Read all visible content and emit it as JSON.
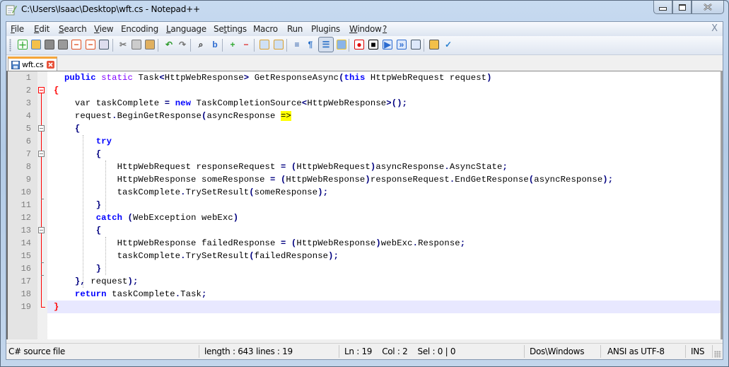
{
  "window": {
    "title": "C:\\Users\\Isaac\\Desktop\\wft.cs - Notepad++",
    "controls": [
      "minimize",
      "maximize",
      "close"
    ]
  },
  "menu": {
    "items": [
      {
        "label": "File",
        "accel": "F"
      },
      {
        "label": "Edit",
        "accel": "E"
      },
      {
        "label": "Search",
        "accel": "S"
      },
      {
        "label": "View",
        "accel": "V"
      },
      {
        "label": "Encoding",
        "accel": ""
      },
      {
        "label": "Language",
        "accel": "L"
      },
      {
        "label": "Settings",
        "accel": "t"
      },
      {
        "label": "Macro",
        "accel": ""
      },
      {
        "label": "Run",
        "accel": ""
      },
      {
        "label": "Plugins",
        "accel": ""
      },
      {
        "label": "Window",
        "accel": "W"
      },
      {
        "label": "?",
        "accel": "?"
      }
    ],
    "close_label": "X"
  },
  "toolbar": {
    "buttons": [
      "new-file-icon",
      "open-file-icon",
      "save-icon",
      "save-all-icon",
      "close-icon",
      "close-all-icon",
      "print-icon",
      "cut-icon",
      "copy-icon",
      "paste-icon",
      "undo-icon",
      "redo-icon",
      "find-icon",
      "replace-icon",
      "zoom-in-icon",
      "zoom-out-icon",
      "sync-vertical-icon",
      "sync-horizontal-icon",
      "word-wrap-icon",
      "show-all-chars-icon",
      "indent-guide-icon",
      "user-language-icon",
      "record-macro-icon",
      "stop-macro-icon",
      "play-macro-icon",
      "run-macro-multiple-icon",
      "save-macro-icon",
      "folder-as-workspace-icon",
      "spell-check-icon"
    ],
    "active": "indent-guide-icon"
  },
  "tabs": [
    {
      "label": "wft.cs",
      "active": true
    }
  ],
  "editor": {
    "current_line": 19,
    "lines": [
      {
        "n": "1",
        "tokens": [
          [
            "",
            "  "
          ],
          [
            "kw",
            "public"
          ],
          [
            "",
            " "
          ],
          [
            "kw2",
            "static"
          ],
          [
            "",
            " Task"
          ],
          [
            "op",
            "<"
          ],
          [
            "",
            "HttpWebResponse"
          ],
          [
            "op",
            ">"
          ],
          [
            "",
            " GetResponseAsync"
          ],
          [
            "op",
            "("
          ],
          [
            "kw",
            "this"
          ],
          [
            "",
            " HttpWebRequest request"
          ],
          [
            "op",
            ")"
          ]
        ]
      },
      {
        "n": "2",
        "tokens": [
          [
            "red",
            "{"
          ]
        ]
      },
      {
        "n": "3",
        "tokens": [
          [
            "",
            "    var taskComplete "
          ],
          [
            "op",
            "="
          ],
          [
            "",
            " "
          ],
          [
            "kw",
            "new"
          ],
          [
            "",
            " TaskCompletionSource"
          ],
          [
            "op",
            "<"
          ],
          [
            "",
            "HttpWebResponse"
          ],
          [
            "op",
            ">();"
          ]
        ]
      },
      {
        "n": "4",
        "tokens": [
          [
            "",
            "    request"
          ],
          [
            "op",
            "."
          ],
          [
            "",
            "BeginGetResponse"
          ],
          [
            "op",
            "("
          ],
          [
            "",
            "asyncResponse "
          ],
          [
            "hl",
            "=>"
          ]
        ]
      },
      {
        "n": "5",
        "tokens": [
          [
            "",
            "    "
          ],
          [
            "op",
            "{"
          ]
        ]
      },
      {
        "n": "6",
        "tokens": [
          [
            "",
            "        "
          ],
          [
            "kw",
            "try"
          ]
        ]
      },
      {
        "n": "7",
        "tokens": [
          [
            "",
            "        "
          ],
          [
            "op",
            "{"
          ]
        ]
      },
      {
        "n": "8",
        "tokens": [
          [
            "",
            "            HttpWebRequest responseRequest "
          ],
          [
            "op",
            "="
          ],
          [
            "",
            " "
          ],
          [
            "op",
            "("
          ],
          [
            "",
            "HttpWebRequest"
          ],
          [
            "op",
            ")"
          ],
          [
            "",
            "asyncResponse"
          ],
          [
            "op",
            "."
          ],
          [
            "",
            "AsyncState"
          ],
          [
            "op",
            ";"
          ]
        ]
      },
      {
        "n": "9",
        "tokens": [
          [
            "",
            "            HttpWebResponse someResponse "
          ],
          [
            "op",
            "="
          ],
          [
            "",
            " "
          ],
          [
            "op",
            "("
          ],
          [
            "",
            "HttpWebResponse"
          ],
          [
            "op",
            ")"
          ],
          [
            "",
            "responseRequest"
          ],
          [
            "op",
            "."
          ],
          [
            "",
            "EndGetResponse"
          ],
          [
            "op",
            "("
          ],
          [
            "",
            "asyncResponse"
          ],
          [
            "op",
            ");"
          ]
        ]
      },
      {
        "n": "10",
        "tokens": [
          [
            "",
            "            taskComplete"
          ],
          [
            "op",
            "."
          ],
          [
            "",
            "TrySetResult"
          ],
          [
            "op",
            "("
          ],
          [
            "",
            "someResponse"
          ],
          [
            "op",
            ");"
          ]
        ]
      },
      {
        "n": "11",
        "tokens": [
          [
            "",
            "        "
          ],
          [
            "op",
            "}"
          ]
        ]
      },
      {
        "n": "12",
        "tokens": [
          [
            "",
            "        "
          ],
          [
            "kw",
            "catch"
          ],
          [
            "",
            " "
          ],
          [
            "op",
            "("
          ],
          [
            "",
            "WebException webExc"
          ],
          [
            "op",
            ")"
          ]
        ]
      },
      {
        "n": "13",
        "tokens": [
          [
            "",
            "        "
          ],
          [
            "op",
            "{"
          ]
        ]
      },
      {
        "n": "14",
        "tokens": [
          [
            "",
            "            HttpWebResponse failedResponse "
          ],
          [
            "op",
            "="
          ],
          [
            "",
            " "
          ],
          [
            "op",
            "("
          ],
          [
            "",
            "HttpWebResponse"
          ],
          [
            "op",
            ")"
          ],
          [
            "",
            "webExc"
          ],
          [
            "op",
            "."
          ],
          [
            "",
            "Response"
          ],
          [
            "op",
            ";"
          ]
        ]
      },
      {
        "n": "15",
        "tokens": [
          [
            "",
            "            taskComplete"
          ],
          [
            "op",
            "."
          ],
          [
            "",
            "TrySetResult"
          ],
          [
            "op",
            "("
          ],
          [
            "",
            "failedResponse"
          ],
          [
            "op",
            ");"
          ]
        ]
      },
      {
        "n": "16",
        "tokens": [
          [
            "",
            "        "
          ],
          [
            "op",
            "}"
          ]
        ]
      },
      {
        "n": "17",
        "tokens": [
          [
            "",
            "    "
          ],
          [
            "op",
            "},"
          ],
          [
            "",
            " request"
          ],
          [
            "op",
            ");"
          ]
        ]
      },
      {
        "n": "18",
        "tokens": [
          [
            "",
            "    "
          ],
          [
            "kw",
            "return"
          ],
          [
            "",
            " taskComplete"
          ],
          [
            "op",
            "."
          ],
          [
            "",
            "Task"
          ],
          [
            "op",
            ";"
          ]
        ]
      },
      {
        "n": "19",
        "tokens": [
          [
            "red",
            "}"
          ]
        ]
      }
    ]
  },
  "status": {
    "file_type": "C# source file",
    "length": "length : 643",
    "lines": "lines : 19",
    "position": "Ln : 19    Col : 2    Sel : 0 | 0",
    "eol": "Dos\\Windows",
    "encoding": "ANSI as UTF-8",
    "mode": "INS"
  }
}
